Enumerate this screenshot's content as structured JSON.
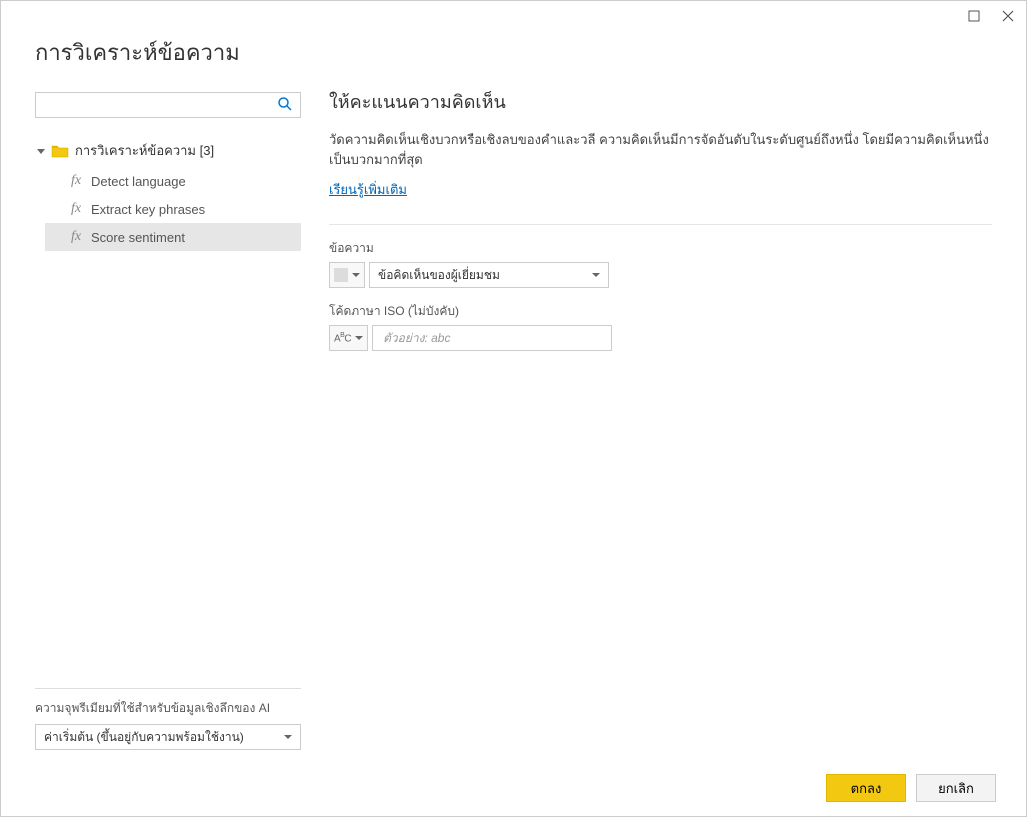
{
  "dialog": {
    "title": "การวิเคราะห์ข้อความ"
  },
  "search": {
    "value": "",
    "placeholder": ""
  },
  "tree": {
    "root_label": "การวิเคราะห์ข้อความ [3]",
    "items": [
      {
        "label": "Detect language"
      },
      {
        "label": "Extract key phrases"
      },
      {
        "label": "Score sentiment"
      }
    ]
  },
  "capacity": {
    "label": "ความจุพรีเมียมที่ใช้สำหรับข้อมูลเชิงลึกของ AI",
    "value": "ค่าเริ่มต้น (ขึ้นอยู่กับความพร้อมใช้งาน)"
  },
  "function": {
    "title": "ให้คะแนนความคิดเห็น",
    "description": "วัดความคิดเห็นเชิงบวกหรือเชิงลบของคำและวลี ความคิดเห็นมีการจัดอันดับในระดับศูนย์ถึงหนึ่ง โดยมีความคิดเห็นหนึ่งเป็นบวกมากที่สุด",
    "learn_more": "เรียนรู้เพิ่มเติม",
    "field1": {
      "label": "ข้อความ",
      "value": "ข้อคิดเห็นของผู้เยี่ยมชม"
    },
    "field2": {
      "label": "โค้ดภาษา ISO (ไม่บังคับ)",
      "placeholder": "ตัวอย่าง: abc",
      "value": ""
    }
  },
  "buttons": {
    "ok": "ตกลง",
    "cancel": "ยกเลิก"
  }
}
